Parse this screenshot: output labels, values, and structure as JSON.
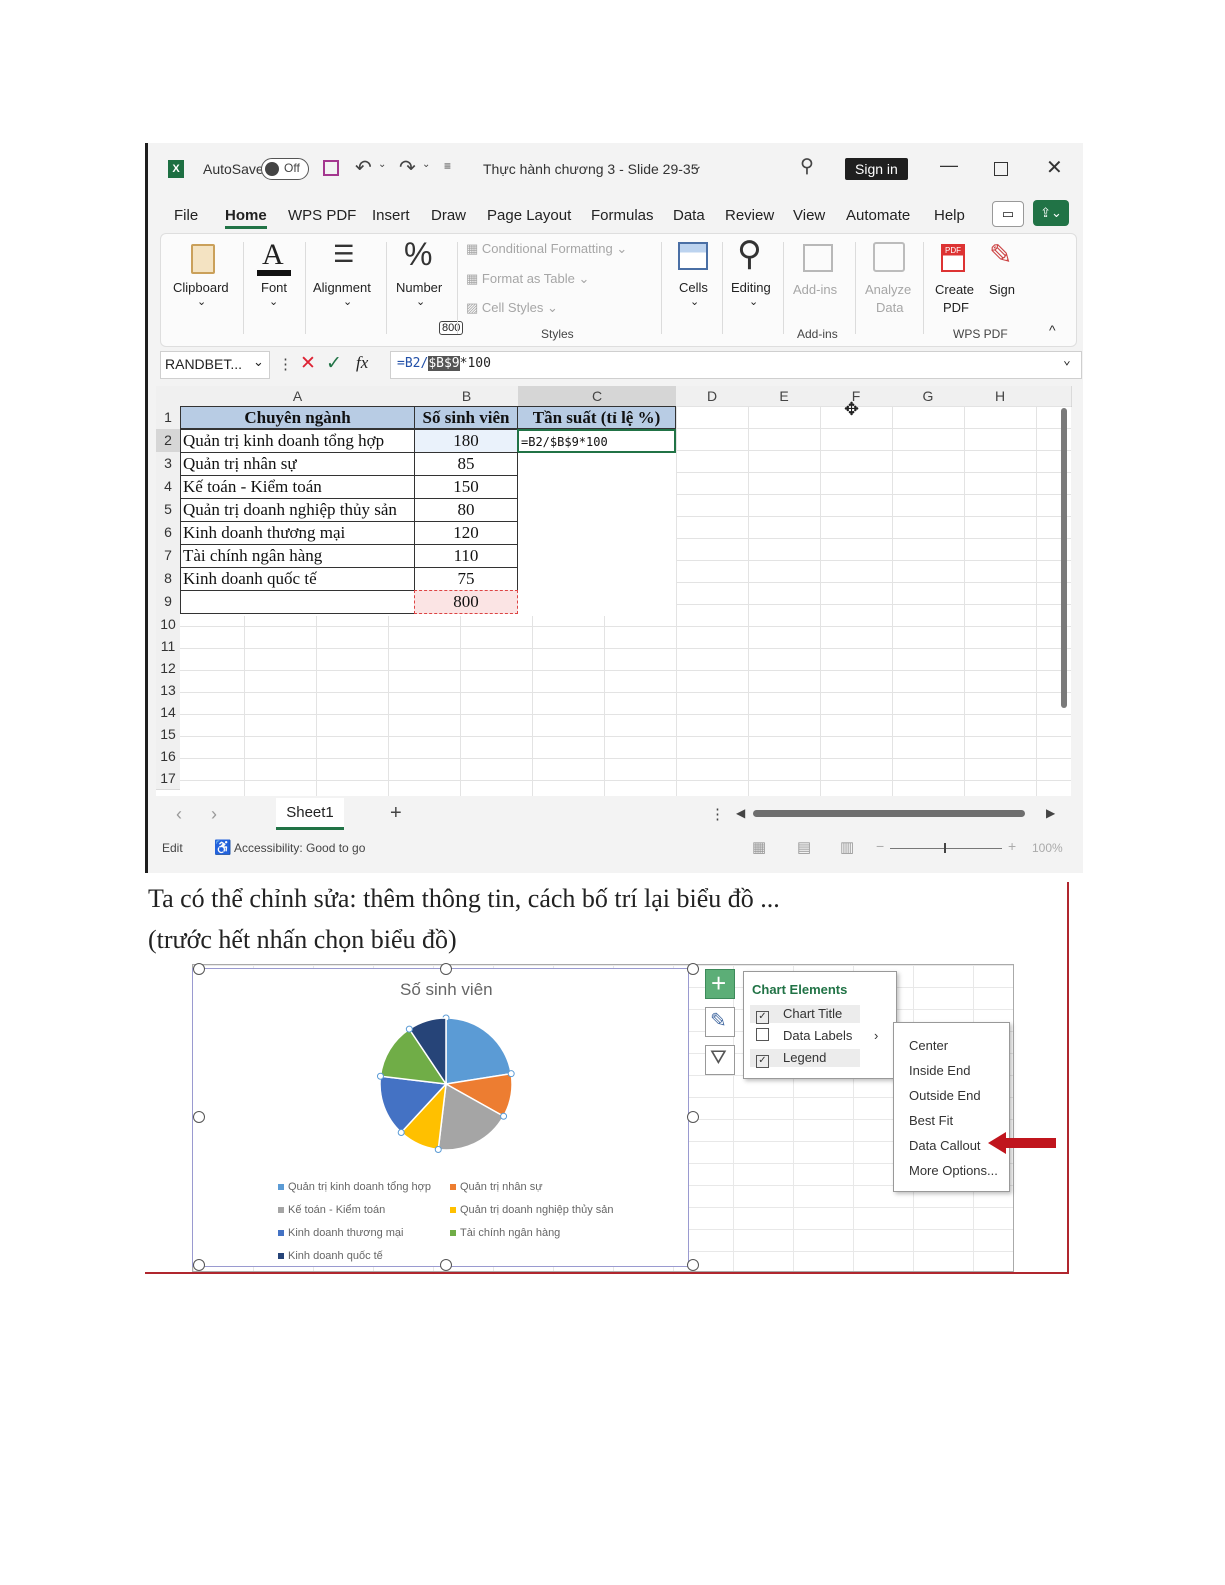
{
  "excel": {
    "titlebar": {
      "autosave_label": "AutoSave",
      "toggle_state": "Off",
      "doc_title": "Thực hành chương 3 - Slide 29-35",
      "sign_in": "Sign in"
    },
    "menu": [
      "File",
      "Home",
      "WPS PDF",
      "Insert",
      "Draw",
      "Page Layout",
      "Formulas",
      "Data",
      "Review",
      "View",
      "Automate",
      "Help"
    ],
    "active_menu": "Home",
    "ribbon": {
      "clipboard": "Clipboard",
      "font": "Font",
      "alignment": "Alignment",
      "number": "Number",
      "tooltip_value": "800",
      "conditional_formatting": "Conditional Formatting",
      "format_as_table": "Format as Table",
      "cell_styles": "Cell Styles",
      "styles_group": "Styles",
      "cells": "Cells",
      "editing": "Editing",
      "add_ins": "Add-ins",
      "add_ins_group": "Add-ins",
      "analyze_data_1": "Analyze",
      "analyze_data_2": "Data",
      "create_pdf_1": "Create",
      "create_pdf_2": "PDF",
      "sign": "Sign",
      "wps_pdf_group": "WPS PDF"
    },
    "formula_bar": {
      "name_box": "RANDBET...",
      "fx": "fx",
      "formula_prefix": "=B2/",
      "formula_highlight": "$B$9",
      "formula_suffix": "*100"
    },
    "columns": [
      "A",
      "B",
      "C",
      "D",
      "E",
      "F",
      "G",
      "H"
    ],
    "rows": [
      "1",
      "2",
      "3",
      "4",
      "5",
      "6",
      "7",
      "8",
      "9",
      "10",
      "11",
      "12",
      "13",
      "14",
      "15",
      "16",
      "17"
    ],
    "table": {
      "headers": [
        "Chuyên ngành",
        "Số sinh viên",
        "Tần suất (tỉ lệ %)"
      ],
      "data": [
        {
          "name": "Quản trị kinh doanh tổng hợp",
          "count": "180"
        },
        {
          "name": "Quản trị nhân sự",
          "count": "85"
        },
        {
          "name": "Kế toán - Kiểm toán",
          "count": "150"
        },
        {
          "name": "Quản trị doanh nghiệp thủy sản",
          "count": "80"
        },
        {
          "name": "Kinh doanh thương mại",
          "count": "120"
        },
        {
          "name": "Tài chính ngân hàng",
          "count": "110"
        },
        {
          "name": "Kinh doanh quốc tế",
          "count": "75"
        }
      ],
      "total": "800",
      "c2_formula": "=B2/$B$9*100"
    },
    "sheet_tab": "Sheet1",
    "status": {
      "mode": "Edit",
      "accessibility": "Accessibility: Good to go",
      "zoom": "100%"
    }
  },
  "slide": {
    "line1": "Ta có thể chỉnh sửa: thêm thông tin, cách bố trí lại biểu đồ ...",
    "line2": "(trước hết nhấn chọn biểu đồ)",
    "chart_title": "Số sinh viên",
    "chart_elements": {
      "title": "Chart Elements",
      "items": [
        {
          "label": "Chart Title",
          "checked": true
        },
        {
          "label": "Data Labels",
          "checked": false
        },
        {
          "label": "Legend",
          "checked": true
        }
      ]
    },
    "data_labels_submenu": [
      "Center",
      "Inside End",
      "Outside End",
      "Best Fit",
      "Data Callout",
      "More Options..."
    ]
  },
  "colors": {
    "excel_green": "#217346",
    "header_fill": "#b8cce4",
    "arrow_red": "#c0151d"
  },
  "chart_data": {
    "type": "pie",
    "title": "Số sinh viên",
    "categories": [
      "Quản trị kinh doanh tổng hợp",
      "Quản trị nhân sự",
      "Kế toán - Kiểm toán",
      "Quản trị doanh nghiệp thủy sản",
      "Kinh doanh thương mại",
      "Tài chính ngân hàng",
      "Kinh doanh quốc tế"
    ],
    "values": [
      180,
      85,
      150,
      80,
      120,
      110,
      75
    ],
    "colors": [
      "#5b9bd5",
      "#ed7d31",
      "#a5a5a5",
      "#ffc000",
      "#4472c4",
      "#70ad47",
      "#264478"
    ],
    "legend": "bottom"
  }
}
